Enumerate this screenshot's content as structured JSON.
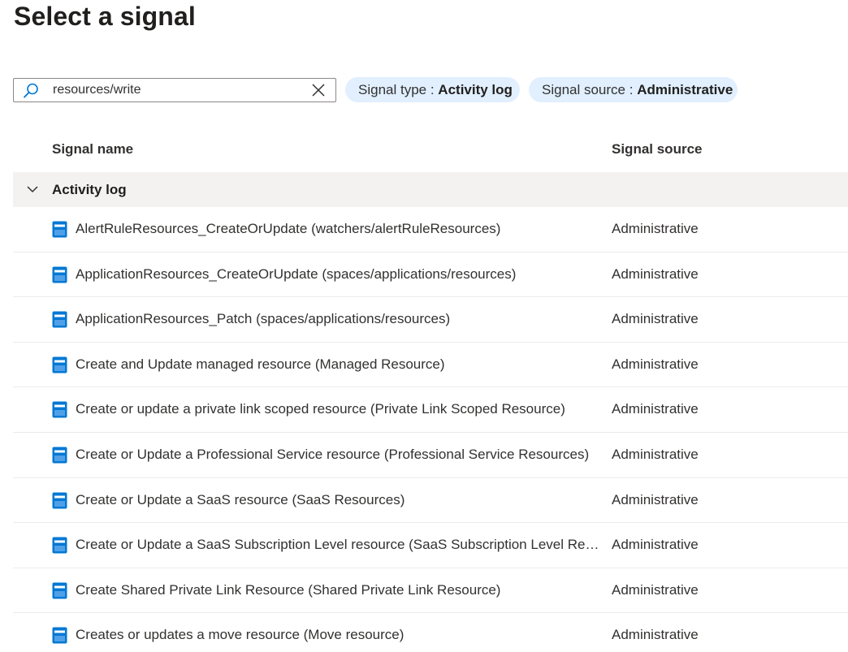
{
  "page": {
    "title": "Select a signal"
  },
  "search": {
    "value": "resources/write",
    "placeholder": ""
  },
  "filters": {
    "signal_type": {
      "label": "Signal type",
      "separator": " : ",
      "value": "Activity log"
    },
    "signal_source": {
      "label": "Signal source",
      "separator": " : ",
      "value": "Administrative"
    }
  },
  "table": {
    "headers": {
      "name": "Signal name",
      "source": "Signal source"
    },
    "group": {
      "label": "Activity log",
      "expanded": true
    },
    "rows": [
      {
        "name": "AlertRuleResources_CreateOrUpdate (watchers/alertRuleResources)",
        "source": "Administrative"
      },
      {
        "name": "ApplicationResources_CreateOrUpdate (spaces/applications/resources)",
        "source": "Administrative"
      },
      {
        "name": "ApplicationResources_Patch (spaces/applications/resources)",
        "source": "Administrative"
      },
      {
        "name": "Create and Update managed resource (Managed Resource)",
        "source": "Administrative"
      },
      {
        "name": "Create or update a private link scoped resource (Private Link Scoped Resource)",
        "source": "Administrative"
      },
      {
        "name": "Create or Update a Professional Service resource (Professional Service Resources)",
        "source": "Administrative"
      },
      {
        "name": "Create or Update a SaaS resource (SaaS Resources)",
        "source": "Administrative"
      },
      {
        "name": "Create or Update a SaaS Subscription Level resource (SaaS Subscription Level Resources)",
        "source": "Administrative"
      },
      {
        "name": "Create Shared Private Link Resource (Shared Private Link Resource)",
        "source": "Administrative"
      },
      {
        "name": "Creates or updates a move resource (Move resource)",
        "source": "Administrative"
      }
    ]
  },
  "icons": {
    "search": "search-icon",
    "clear": "close-icon",
    "group_toggle": "chevron-down-icon",
    "row": "activity-log-signal-icon"
  },
  "colors": {
    "accent": "#0078d4",
    "pill_bg": "#e1efff",
    "group_bg": "#f3f2f1",
    "divider": "#edebe9"
  }
}
